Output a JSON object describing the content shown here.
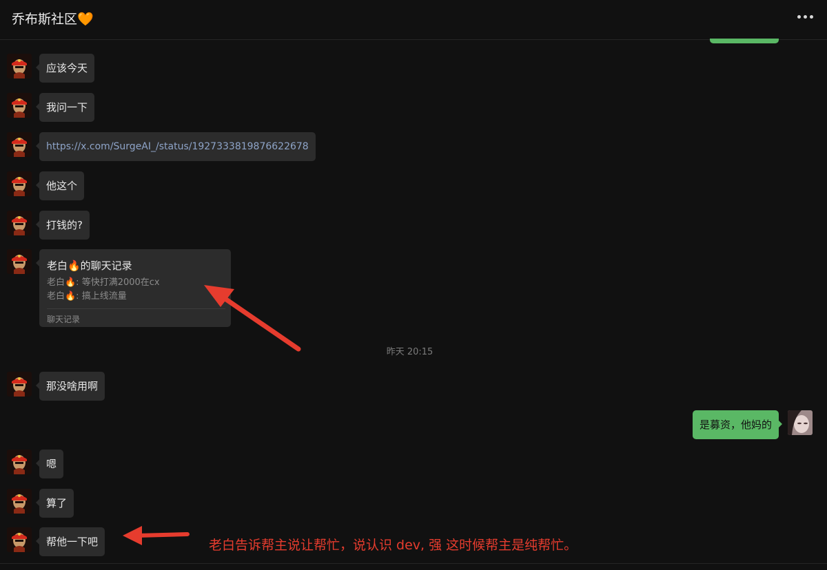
{
  "header": {
    "title": "乔布斯社区🧡"
  },
  "messages": [
    {
      "text": "应该今天"
    },
    {
      "text": "我问一下"
    },
    {
      "text": "https://x.com/SurgeAI_/status/1927333819876622678"
    },
    {
      "text": "他这个"
    },
    {
      "text": "打钱的?"
    },
    {
      "card": {
        "title": "老白🔥的聊天记录",
        "line1": "老白🔥: 等快打满2000在cx",
        "line2": "老白🔥: 搞上线流量",
        "footer": "聊天记录"
      }
    },
    {
      "text": "那没啥用啊"
    },
    {
      "text": "是募资，他妈的"
    },
    {
      "text": "嗯"
    },
    {
      "text": "算了"
    },
    {
      "text": "帮他一下吧"
    }
  ],
  "timestamp": "昨天 20:15",
  "annotation": "老白告诉帮主说让帮忙，说认识 dev, 强 这时候帮主是纯帮忙。",
  "colors": {
    "background": "#111111",
    "bubble_other": "#2c2c2c",
    "bubble_mine": "#5ab865",
    "annotation": "#e63c2e",
    "link": "#8ea4c8"
  },
  "icons": {
    "menu": "more-horizontal-icon"
  }
}
